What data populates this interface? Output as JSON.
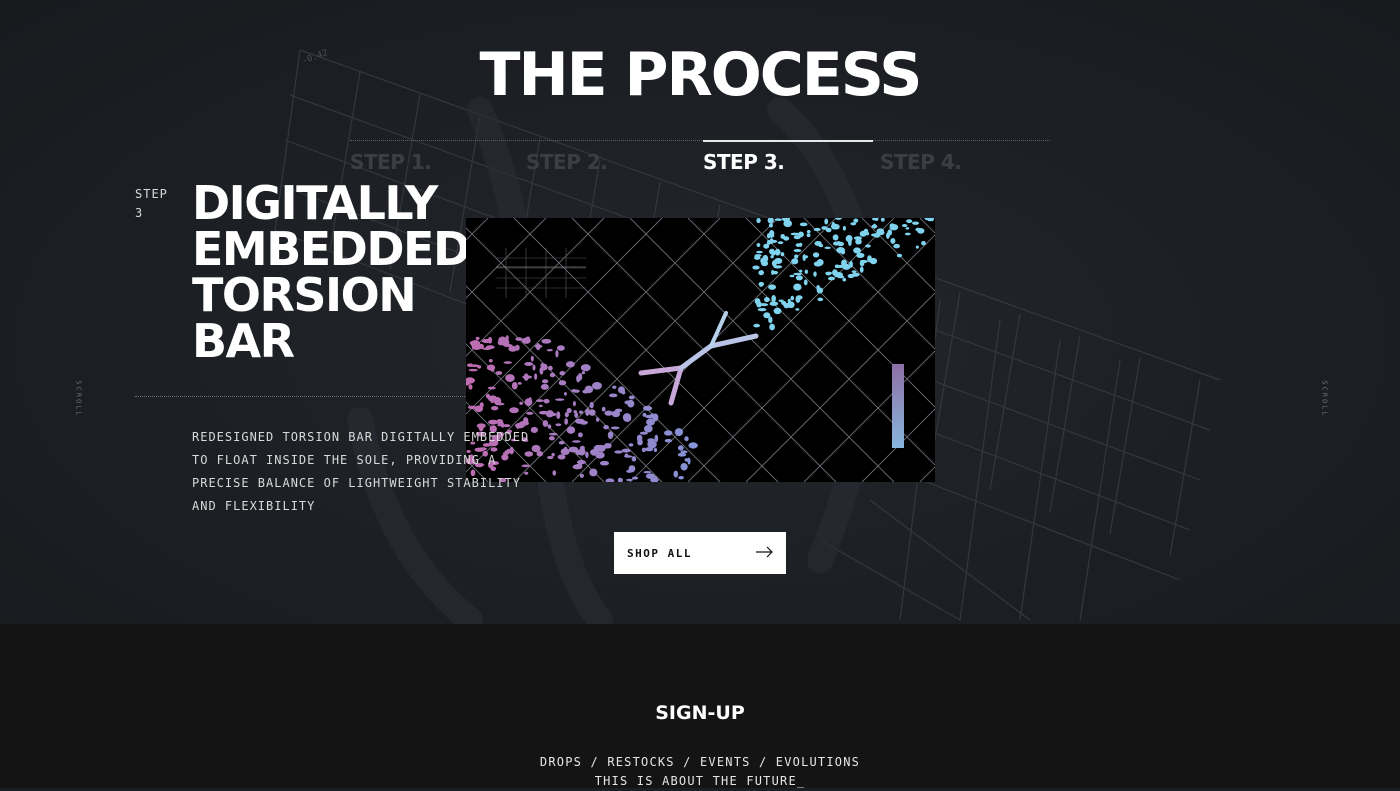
{
  "process": {
    "title": "THE PROCESS",
    "steps": [
      {
        "label": "STEP 1.",
        "active": false
      },
      {
        "label": "STEP 2.",
        "active": false
      },
      {
        "label": "STEP 3.",
        "active": true
      },
      {
        "label": "STEP 4.",
        "active": false
      }
    ],
    "current_step_prefix": "STEP",
    "current_step_number": "3",
    "headline_lines": [
      "DIGITALLY",
      "EMBEDDED",
      "TORSION",
      "BAR"
    ],
    "description_lines": [
      "REDESIGNED TORSION BAR DIGITALLY EMBEDDED",
      "TO FLOAT INSIDE THE SOLE, PROVIDING A",
      "PRECISE BALANCE OF LIGHTWEIGHT STABILITY",
      "AND FLEXIBILITY"
    ],
    "shop_button_label": "SHOP ALL",
    "scroll_label": "SCROLL",
    "colors": {
      "background": "#1b1e23",
      "accent_pink": "#c06bb0",
      "accent_cyan": "#7fd3ee",
      "button_bg": "#ffffff"
    }
  },
  "signup": {
    "title": "SIGN-UP",
    "line1": "DROPS / RESTOCKS / EVENTS / EVOLUTIONS",
    "line2": "THIS IS ABOUT THE FUTURE_"
  }
}
